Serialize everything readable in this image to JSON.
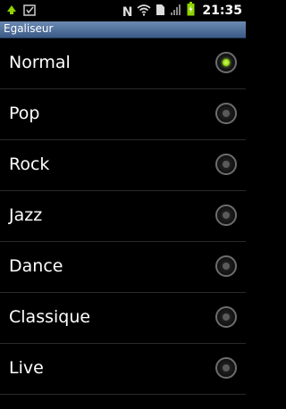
{
  "status_bar": {
    "time": "21:35",
    "left_icons": [
      "usb-debug-icon",
      "download-done-icon"
    ],
    "right_icons": [
      "nfc-icon",
      "wifi-icon",
      "sim-icon",
      "signal-icon",
      "battery-charging-icon"
    ],
    "nfc_label": "N"
  },
  "title": "Egaliseur",
  "presets": [
    {
      "label": "Normal",
      "selected": true
    },
    {
      "label": "Pop",
      "selected": false
    },
    {
      "label": "Rock",
      "selected": false
    },
    {
      "label": "Jazz",
      "selected": false
    },
    {
      "label": "Dance",
      "selected": false
    },
    {
      "label": "Classique",
      "selected": false
    },
    {
      "label": "Live",
      "selected": false
    }
  ],
  "colors": {
    "accent_selected": "#8fd400",
    "title_bar": "#4a6a96"
  }
}
